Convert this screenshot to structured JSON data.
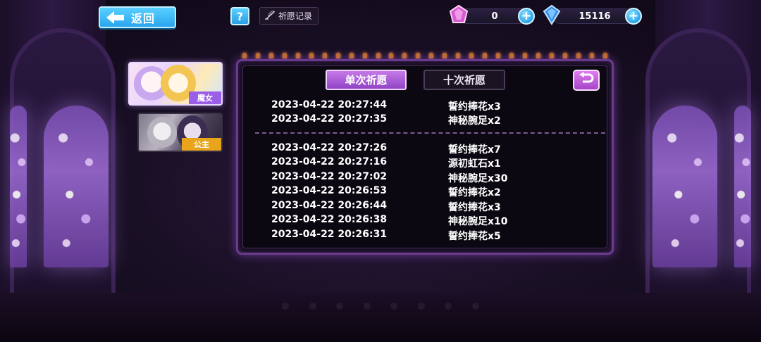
{
  "header": {
    "back_label": "返回",
    "help_label": "?",
    "history_label": "祈愿记录"
  },
  "currencies": [
    {
      "name": "pink-gem",
      "value": "0",
      "color": "#e27ad8"
    },
    {
      "name": "blue-crystal",
      "value": "15116",
      "color": "#4aa8ff"
    }
  ],
  "characters": [
    {
      "label": "魔女",
      "selected": true
    },
    {
      "label": "公主",
      "selected": false
    }
  ],
  "tabs": {
    "single": "单次祈愿",
    "ten": "十次祈愿",
    "active": "single"
  },
  "records": {
    "group1": [
      {
        "time": "2023-04-22 20:27:44",
        "item": "誓约捧花x3"
      },
      {
        "time": "2023-04-22 20:27:35",
        "item": "神秘腕足x2"
      }
    ],
    "group2": [
      {
        "time": "2023-04-22 20:27:26",
        "item": "誓约捧花x7"
      },
      {
        "time": "2023-04-22 20:27:16",
        "item": "源初虹石x1"
      },
      {
        "time": "2023-04-22 20:27:02",
        "item": "神秘腕足x30"
      },
      {
        "time": "2023-04-22 20:26:53",
        "item": "誓约捧花x2"
      },
      {
        "time": "2023-04-22 20:26:44",
        "item": "誓约捧花x3"
      },
      {
        "time": "2023-04-22 20:26:38",
        "item": "神秘腕足x10"
      },
      {
        "time": "2023-04-22 20:26:31",
        "item": "誓约捧花x5"
      }
    ]
  },
  "colors": {
    "accent_blue": "#2aa5ee",
    "accent_purple": "#9143c4",
    "panel_border": "#6c3b8e"
  }
}
